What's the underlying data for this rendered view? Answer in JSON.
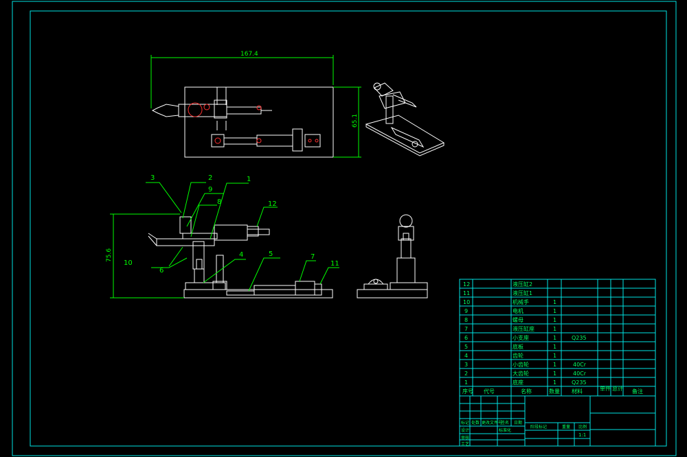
{
  "colors": {
    "background": "#000000",
    "frame": "#00e5e5",
    "geometry": "#ffffff",
    "dimension": "#00ff00",
    "text": "#00ff66"
  },
  "dimensions": {
    "top_width": "167.4",
    "top_height": "65.1",
    "front_height": "75.6"
  },
  "balloons": [
    "1",
    "2",
    "3",
    "4",
    "5",
    "6",
    "7",
    "8",
    "9",
    "10",
    "11",
    "12"
  ],
  "bom": {
    "rows": [
      {
        "no": "12",
        "name": "液压缸2",
        "qty": "",
        "material": ""
      },
      {
        "no": "11",
        "name": "液压缸1",
        "qty": "",
        "material": ""
      },
      {
        "no": "10",
        "name": "机械手",
        "qty": "1",
        "material": ""
      },
      {
        "no": "9",
        "name": "电机",
        "qty": "1",
        "material": ""
      },
      {
        "no": "8",
        "name": "螺母",
        "qty": "1",
        "material": ""
      },
      {
        "no": "7",
        "name": "液压缸座",
        "qty": "1",
        "material": ""
      },
      {
        "no": "6",
        "name": "小支座",
        "qty": "1",
        "material": "Q235"
      },
      {
        "no": "5",
        "name": "底板",
        "qty": "1",
        "material": ""
      },
      {
        "no": "4",
        "name": "齿轮",
        "qty": "1",
        "material": ""
      },
      {
        "no": "3",
        "name": "小齿轮",
        "qty": "1",
        "material": "40Cr"
      },
      {
        "no": "2",
        "name": "大齿轮",
        "qty": "1",
        "material": "40Cr"
      },
      {
        "no": "1",
        "name": "底座",
        "qty": "1",
        "material": "Q235"
      }
    ],
    "header": [
      "序号",
      "代号",
      "名称",
      "数量",
      "材料",
      "",
      "单件",
      "总计",
      "备注"
    ]
  },
  "title_block": {
    "labels": [
      "标记",
      "处数",
      "更改文件号",
      "签名",
      "日期",
      "设计",
      "标准化",
      "审核",
      "工艺",
      "阶段标记",
      "重量",
      "比例"
    ],
    "scale": "1:1"
  }
}
